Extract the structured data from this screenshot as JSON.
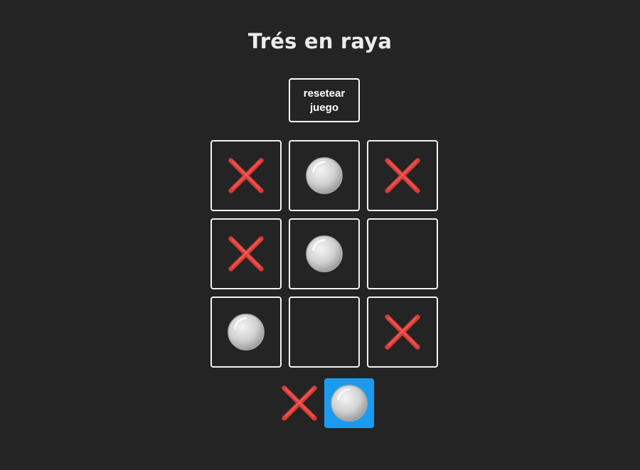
{
  "header": {
    "title": "Trés en raya"
  },
  "controls": {
    "reset_label": "resetear juego"
  },
  "board": {
    "cells": [
      "X",
      "O",
      "X",
      "X",
      "O",
      "",
      "O",
      "",
      "X"
    ]
  },
  "turn_indicator": {
    "options": [
      "X",
      "O"
    ],
    "active": "O"
  },
  "colors": {
    "background": "#242424",
    "x_mark": "#dd3b36",
    "o_mark": "#d2d2d2",
    "active_turn": "#1a9bf0",
    "border": "#f2f2f2"
  },
  "icons": {
    "X": "cross-mark-icon",
    "O": "white-circle-icon"
  }
}
